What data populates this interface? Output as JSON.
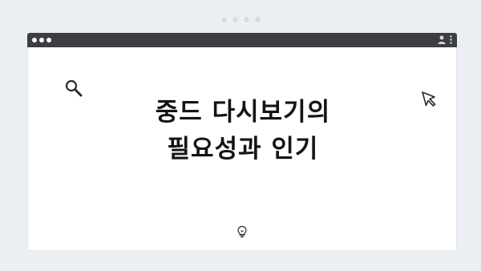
{
  "window": {
    "controls": [
      "window-dot-1",
      "window-dot-2",
      "window-dot-3"
    ],
    "right_icons": [
      "person-icon",
      "kebab-menu-icon"
    ]
  },
  "slide": {
    "title_line1": "중드 다시보기의",
    "title_line2": "필요성과 인기",
    "icons": [
      "search-icon",
      "cursor-icon",
      "lightbulb-icon"
    ]
  },
  "colors": {
    "page_bg": "#ebeef2",
    "titlebar": "#3c3e43",
    "content_bg": "#ffffff",
    "text": "#141414"
  }
}
